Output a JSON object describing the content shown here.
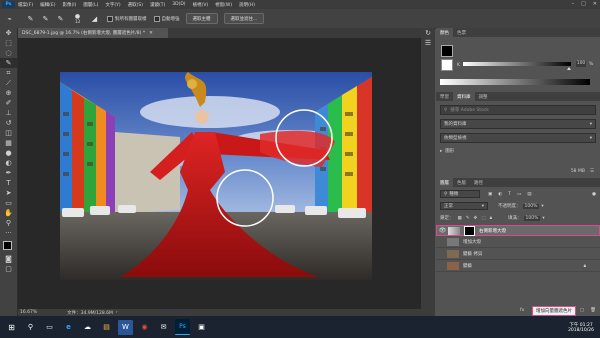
{
  "app": {
    "logo": "Ps"
  },
  "menubar": {
    "items": [
      "檔案(F)",
      "編輯(E)",
      "影像(I)",
      "圖層(L)",
      "文字(Y)",
      "選取(S)",
      "濾鏡(T)",
      "3D(D)",
      "檢視(V)",
      "視窗(W)",
      "說明(H)"
    ],
    "window_controls": [
      "–",
      "□",
      "✕"
    ]
  },
  "options": {
    "sample_all_label": "對所有圖層取樣",
    "auto_enhance_label": "自動增強",
    "select_subject_label": "選取主體",
    "select_mask_label": "選取並遮住...",
    "brush_size": "13"
  },
  "document": {
    "tab_title": "DSC_6879-1.jpg @ 16.7% (右側新增大燈, 圖層遮色片/8) *",
    "zoom": "16.67%",
    "doc_info": "文件：34.9M/128.6M"
  },
  "color_panel": {
    "tabs": [
      "顏色",
      "色票"
    ],
    "k_label": "K",
    "k_value": "100",
    "k_unit": "%"
  },
  "libraries_panel": {
    "tabs": [
      "學習",
      "資料庫",
      "調整"
    ],
    "search_placeholder": "搜尋 Adobe Stock",
    "library_name": "我的資料庫",
    "view_by": "依類型檢視",
    "group_label": "圖形",
    "storage": "58 MB"
  },
  "layers_panel": {
    "tabs": [
      "圖層",
      "色版",
      "路徑"
    ],
    "filter_label": "種類",
    "blend_mode": "正常",
    "opacity_label": "不透明度：",
    "opacity_value": "100%",
    "lock_label": "鎖定：",
    "fill_label": "填滿：",
    "fill_value": "100%",
    "layers": [
      {
        "name": "右側新增大燈",
        "selected": true
      },
      {
        "name": "增加大燈",
        "selected": false
      },
      {
        "name": "變藝 拷貝",
        "selected": false
      },
      {
        "name": "變藝",
        "selected": false
      }
    ],
    "tooltip": "增加向量圖遮色片"
  },
  "taskbar": {
    "apps": [
      "⊞",
      "⚲",
      "▭",
      "e",
      "☁",
      "▤",
      "W",
      "◉",
      "✉",
      "Ps",
      "▣"
    ],
    "time": "下午 01:27",
    "date": "2018/10/26"
  },
  "colors": {
    "accent": "#31a8ff",
    "panel_bg": "#535353",
    "dark_bg": "#282828"
  }
}
